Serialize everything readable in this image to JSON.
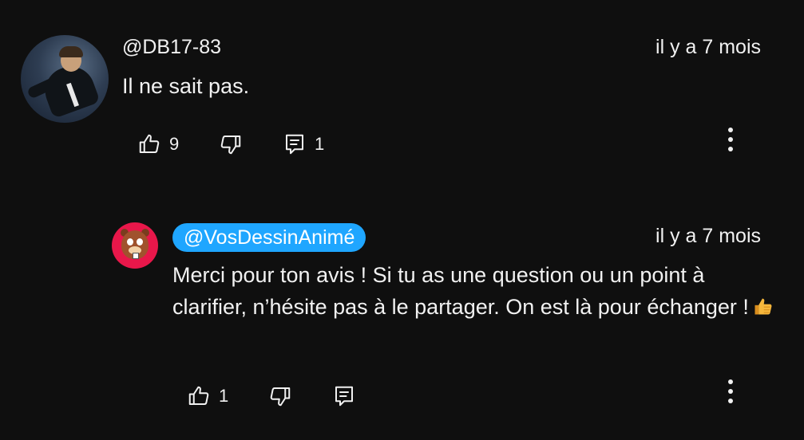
{
  "comment": {
    "author": "@DB17-83",
    "timestamp": "il y a 7 mois",
    "text": "Il ne sait pas.",
    "likes": "9",
    "replies": "1"
  },
  "reply": {
    "author": "@VosDessinAnimé",
    "timestamp": "il y a 7 mois",
    "text": "Merci pour ton avis ! Si tu as une question ou un point à clarifier, n’hésite pas à le partager. On est là pour échanger !",
    "emoji": "thumbs-up-emoji",
    "likes": "1"
  },
  "icons": {
    "like": "thumbs-up-icon",
    "dislike": "thumbs-down-icon",
    "reply": "comment-icon",
    "more": "more-vert-icon"
  },
  "colors": {
    "background": "#0f0f0f",
    "text": "#f1f1f1",
    "creator_badge": "#1fa6ff"
  }
}
